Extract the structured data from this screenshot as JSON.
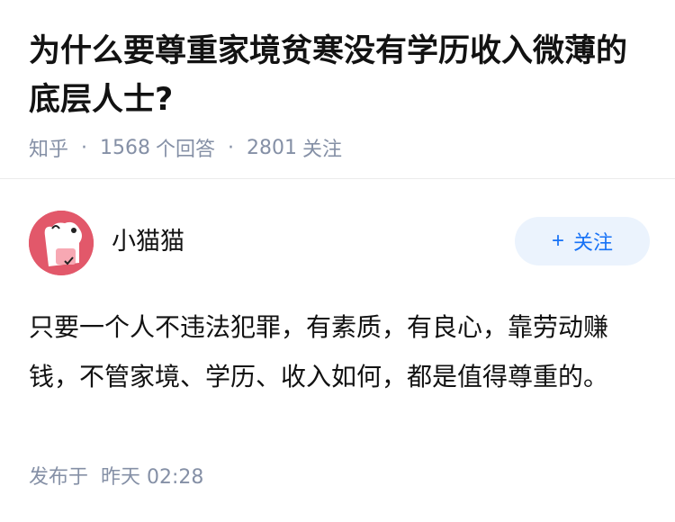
{
  "question": {
    "title": "为什么要尊重家境贫寒没有学历收入微薄的底层人士?",
    "source": "知乎",
    "answer_count": "1568",
    "answer_count_label": "个回答",
    "follower_count": "2801",
    "follower_count_label": "关注"
  },
  "answer": {
    "author_name": "小猫猫",
    "follow_label": "关注",
    "follow_icon": "plus-icon",
    "content": "只要一个人不违法犯罪，有素质，有良心，靠劳动赚钱，不管家境、学历、收入如何，都是值得尊重的。",
    "published_label": "发布于",
    "published_time": "昨天 02:28"
  },
  "colors": {
    "accent": "#1772f6",
    "follow_bg": "#ebf3fd",
    "meta_gray": "#8590a6",
    "avatar_bg": "#e2586a"
  }
}
